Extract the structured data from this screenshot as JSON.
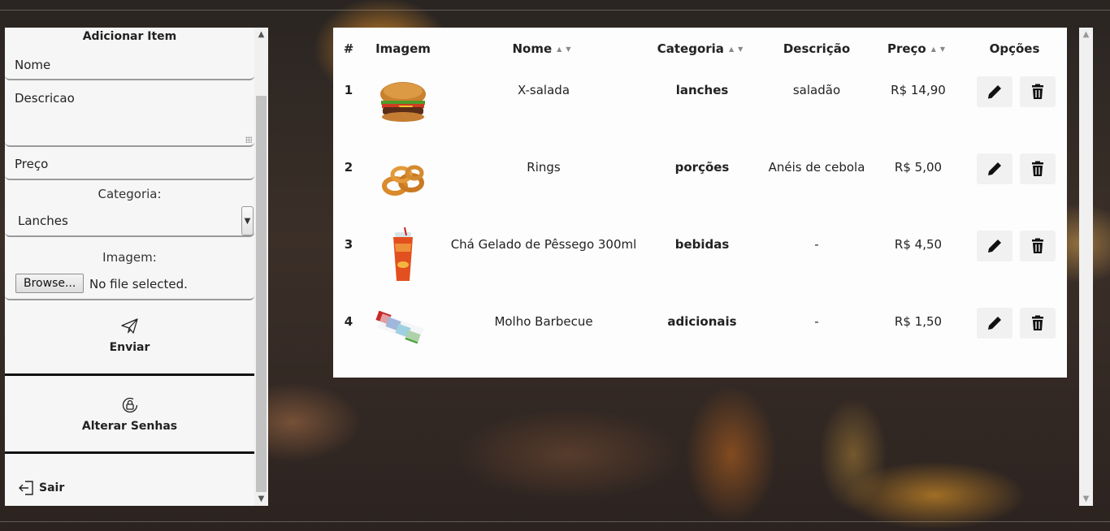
{
  "sidebar": {
    "title": "Adicionar Item",
    "name_placeholder": "Nome",
    "description_placeholder": "Descricao",
    "price_placeholder": "Preço",
    "category_label": "Categoria:",
    "category_selected": "Lanches",
    "image_label": "Imagem:",
    "browse_label": "Browse...",
    "file_status": "No file selected.",
    "submit_label": "Enviar",
    "change_password_label": "Alterar Senhas",
    "logout_label": "Sair"
  },
  "table": {
    "columns": [
      "#",
      "Imagem",
      "Nome",
      "Categoria",
      "Descrição",
      "Preço",
      "Opções"
    ],
    "rows": [
      {
        "id": "1",
        "image": "burger-image",
        "name": "X-salada",
        "category": "lanches",
        "description": "saladão",
        "price": "R$ 14,90"
      },
      {
        "id": "2",
        "image": "onion-rings-image",
        "name": "Rings",
        "category": "porções",
        "description": "Anéis de cebola",
        "price": "R$ 5,00"
      },
      {
        "id": "3",
        "image": "iced-tea-image",
        "name": "Chá Gelado de Pêssego 300ml",
        "category": "bebidas",
        "description": "-",
        "price": "R$ 4,50"
      },
      {
        "id": "4",
        "image": "sauce-sachets-image",
        "name": "Molho Barbecue",
        "category": "adicionais",
        "description": "-",
        "price": "R$ 1,50"
      }
    ]
  },
  "icons": {
    "edit": "pencil-icon",
    "delete": "trash-icon",
    "sort": "sort-arrows-icon",
    "send": "paper-plane-icon",
    "lock": "lock-reset-icon",
    "logout": "logout-icon"
  }
}
